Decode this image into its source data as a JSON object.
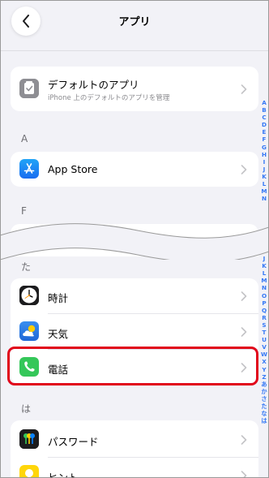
{
  "header": {
    "title": "アプリ"
  },
  "top_card": {
    "title": "デフォルトのアプリ",
    "subtitle": "iPhone 上のデフォルトのアプリを管理"
  },
  "sections": {
    "a": {
      "header": "A",
      "items": [
        {
          "label": "App Store"
        }
      ]
    },
    "f": {
      "header": "F"
    },
    "ta": {
      "header": "た",
      "items": [
        {
          "label": "時計"
        },
        {
          "label": "天気"
        },
        {
          "label": "電話"
        }
      ]
    },
    "ha": {
      "header": "は",
      "items": [
        {
          "label": "パスワード"
        },
        {
          "label": "ヒント"
        }
      ]
    }
  },
  "index_upper": [
    "A",
    "B",
    "C",
    "D",
    "E",
    "F",
    "G",
    "H",
    "I",
    "J",
    "K",
    "L",
    "M",
    "N"
  ],
  "index_lower": [
    "I",
    "J",
    "K",
    "L",
    "M",
    "N",
    "O",
    "P",
    "Q",
    "R",
    "S",
    "T",
    "U",
    "V",
    "W",
    "X",
    "Y",
    "Z",
    "あ",
    "か",
    "さ",
    "た",
    "な",
    "は"
  ],
  "colors": {
    "accent": "#3478f6",
    "highlight": "#e1061b",
    "phone_green": "#34c759",
    "appstore_blue": "#1a8cf0",
    "background": "#f2f2f7"
  }
}
